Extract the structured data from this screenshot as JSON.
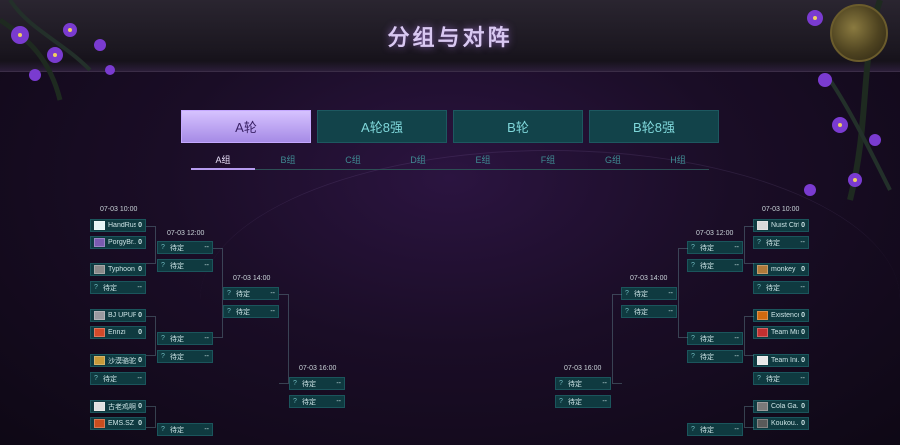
{
  "page": {
    "title": "分组与对阵"
  },
  "colors": {
    "accent": "#b79cf0",
    "tab_bg": "#12434a",
    "slot_bg": "#0f3a40",
    "text": "#cde4e6"
  },
  "round_tabs": [
    {
      "label": "A轮",
      "active": true
    },
    {
      "label": "A轮8强",
      "active": false
    },
    {
      "label": "B轮",
      "active": false
    },
    {
      "label": "B轮8强",
      "active": false
    }
  ],
  "group_tabs": [
    {
      "label": "A组",
      "active": true
    },
    {
      "label": "B组",
      "active": false
    },
    {
      "label": "C组",
      "active": false
    },
    {
      "label": "D组",
      "active": false
    },
    {
      "label": "E组",
      "active": false
    },
    {
      "label": "F组",
      "active": false
    },
    {
      "label": "G组",
      "active": false
    },
    {
      "label": "H组",
      "active": false
    }
  ],
  "bracket_left": {
    "round1_time": "07-03 10:00",
    "round1": [
      {
        "name": "HandRush",
        "score": "0",
        "icon": "handrush-logo-icon",
        "color": "#e6f4f5"
      },
      {
        "name": "PorgyBr...",
        "score": "0",
        "icon": "porgy-logo-icon",
        "color": "#7a5bb0"
      },
      {
        "name": "Typhoon",
        "score": "0",
        "icon": "typhoon-logo-icon",
        "color": "#8a8a8a"
      },
      {
        "name": "待定",
        "score": "--",
        "q": "?"
      },
      {
        "name": "BJ UPUP...",
        "score": "0",
        "icon": "bjupup-logo-icon",
        "color": "#9a9aa0"
      },
      {
        "name": "Ennzi",
        "score": "0",
        "icon": "ennzi-logo-icon",
        "color": "#d24a2a"
      },
      {
        "name": "沙漠骆驼",
        "score": "0",
        "icon": "camel-logo-icon",
        "color": "#c79a3a"
      },
      {
        "name": "待定",
        "score": "--",
        "q": "?"
      },
      {
        "name": "古老鸡啊",
        "score": "0",
        "icon": "chicken-logo-icon",
        "color": "#e0e0e0"
      },
      {
        "name": "EMS.SZ",
        "score": "0",
        "icon": "ems-logo-icon",
        "color": "#c94d1e"
      }
    ],
    "round2_time": "07-03 12:00",
    "round2": [
      {
        "name": "待定",
        "score": "--",
        "q": "?"
      },
      {
        "name": "待定",
        "score": "--",
        "q": "?"
      },
      {
        "name": "待定",
        "score": "--",
        "q": "?"
      },
      {
        "name": "待定",
        "score": "--",
        "q": "?"
      },
      {
        "name": "待定",
        "score": "--",
        "q": "?"
      }
    ],
    "round3_time": "07-03 14:00",
    "round3": [
      {
        "name": "待定",
        "score": "--",
        "q": "?"
      },
      {
        "name": "待定",
        "score": "--",
        "q": "?"
      }
    ],
    "round4_time": "07-03 16:00",
    "round4": [
      {
        "name": "待定",
        "score": "--",
        "q": "?"
      },
      {
        "name": "待定",
        "score": "--",
        "q": "?"
      }
    ]
  },
  "bracket_right": {
    "round1_time": "07-03 10:00",
    "round1": [
      {
        "name": "Nuist Ctrl",
        "score": "0",
        "icon": "nuist-logo-icon",
        "color": "#d8d8d8"
      },
      {
        "name": "待定",
        "score": "--",
        "q": "?"
      },
      {
        "name": "monkey",
        "score": "0",
        "icon": "monkey-logo-icon",
        "color": "#b07a3a"
      },
      {
        "name": "待定",
        "score": "--",
        "q": "?"
      },
      {
        "name": "Existence",
        "score": "0",
        "icon": "existence-logo-icon",
        "color": "#d06a10"
      },
      {
        "name": "Team Mix",
        "score": "0",
        "icon": "teammix-logo-icon",
        "color": "#c13030"
      },
      {
        "name": "Team Ini...",
        "score": "0",
        "icon": "teamini-logo-icon",
        "color": "#e8e8e8"
      },
      {
        "name": "待定",
        "score": "--",
        "q": "?"
      },
      {
        "name": "Cola Ga...",
        "score": "0",
        "icon": "cola-logo-icon",
        "color": "#7a7a7a"
      },
      {
        "name": "Koukou...",
        "score": "0",
        "icon": "koukou-logo-icon",
        "color": "#5a5a5a"
      }
    ],
    "round2_time": "07-03 12:00",
    "round2": [
      {
        "name": "待定",
        "score": "--",
        "q": "?"
      },
      {
        "name": "待定",
        "score": "--",
        "q": "?"
      },
      {
        "name": "待定",
        "score": "--",
        "q": "?"
      },
      {
        "name": "待定",
        "score": "--",
        "q": "?"
      },
      {
        "name": "待定",
        "score": "--",
        "q": "?"
      }
    ],
    "round3_time": "07-03 14:00",
    "round3": [
      {
        "name": "待定",
        "score": "--",
        "q": "?"
      },
      {
        "name": "待定",
        "score": "--",
        "q": "?"
      }
    ],
    "round4_time": "07-03 16:00",
    "round4": [
      {
        "name": "待定",
        "score": "--",
        "q": "?"
      },
      {
        "name": "待定",
        "score": "--",
        "q": "?"
      }
    ]
  }
}
